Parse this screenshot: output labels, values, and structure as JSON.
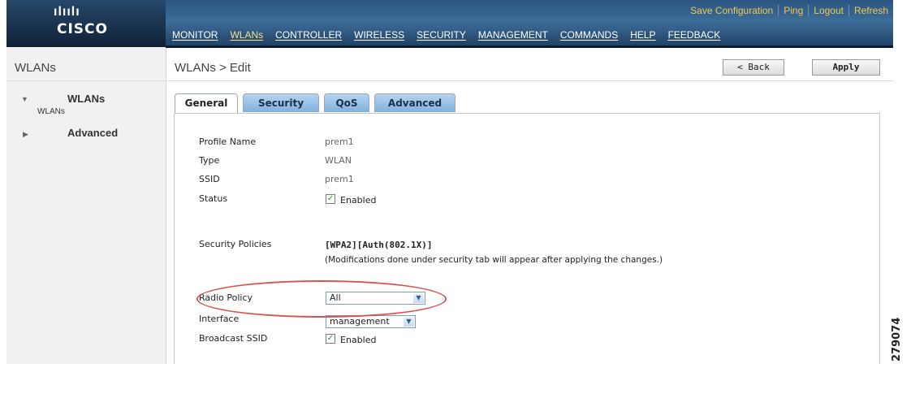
{
  "brand": {
    "logo_bars": "ılıılı",
    "logo_text": "CISCO"
  },
  "utility_links": [
    "Save Configuration",
    "Ping",
    "Logout",
    "Refresh"
  ],
  "main_nav": [
    "MONITOR",
    "WLANs",
    "CONTROLLER",
    "WIRELESS",
    "SECURITY",
    "MANAGEMENT",
    "COMMANDS",
    "HELP",
    "FEEDBACK"
  ],
  "active_nav": "WLANs",
  "sidebar": {
    "title": "WLANs",
    "items": [
      {
        "label": "WLANs",
        "sub": "WLANs",
        "expanded": true
      },
      {
        "label": "Advanced",
        "expanded": false
      }
    ]
  },
  "main": {
    "breadcrumb": "WLANs > Edit",
    "back_label": "< Back",
    "apply_label": "Apply",
    "tabs": [
      "General",
      "Security",
      "QoS",
      "Advanced"
    ],
    "active_tab": "General"
  },
  "form": {
    "profile_name_label": "Profile Name",
    "profile_name_value": "prem1",
    "type_label": "Type",
    "type_value": "WLAN",
    "ssid_label": "SSID",
    "ssid_value": "prem1",
    "status_label": "Status",
    "status_checked": true,
    "status_text": "Enabled",
    "security_policies_label": "Security Policies",
    "security_policies_value": "[WPA2][Auth(802.1X)]",
    "security_policies_note": "(Modifications done under security tab will appear after applying the changes.)",
    "radio_policy_label": "Radio Policy",
    "radio_policy_value": "All",
    "interface_label": "Interface",
    "interface_value": "management",
    "broadcast_ssid_label": "Broadcast SSID",
    "broadcast_ssid_checked": true,
    "broadcast_ssid_text": "Enabled"
  },
  "figure_id": "279074",
  "colors": {
    "highlight": "#d9534f",
    "header": "#2b5580",
    "active_nav": "#f7e08a",
    "util_link": "#f2c94c",
    "tab_inactive": "#7fb1de"
  }
}
